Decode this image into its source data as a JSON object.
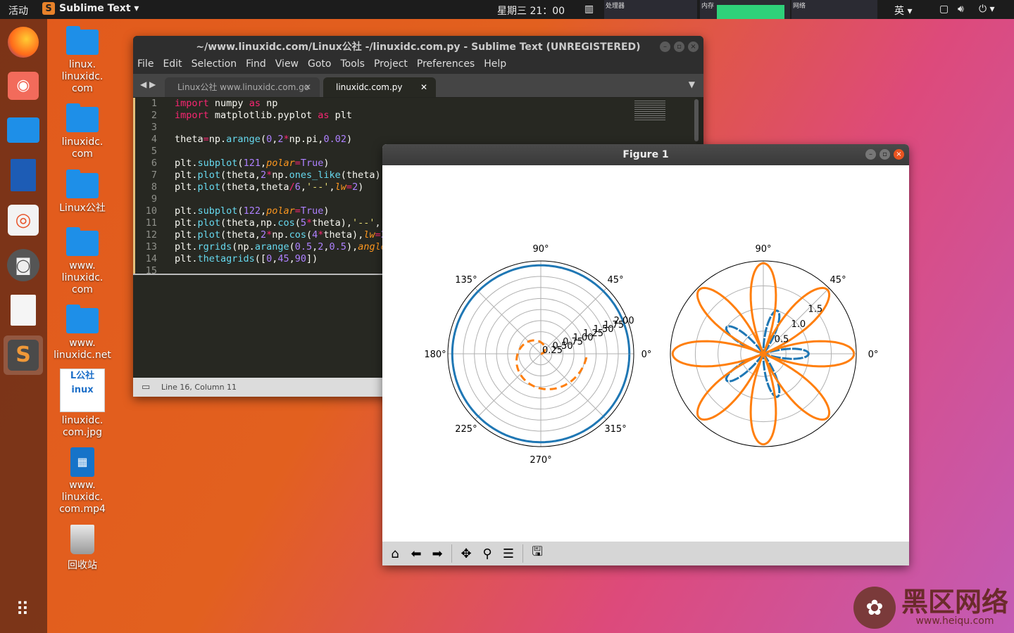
{
  "topbar": {
    "activities": "活动",
    "app_name": "Sublime Text ▾",
    "clock": "星期三 21：00",
    "cpu_label": "处理器",
    "mem_label": "内存",
    "net_label": "网络",
    "ime": "英 ▾"
  },
  "desktop": {
    "icons": [
      {
        "label": "linux.\nlinuxidc.\ncom"
      },
      {
        "label": "linuxidc.\ncom"
      },
      {
        "label": "Linux公社"
      },
      {
        "label": "www.\nlinuxidc.\ncom"
      },
      {
        "label": "www.\nlinuxidc.net"
      },
      {
        "label": "linuxidc.\ncom.jpg"
      },
      {
        "label": "www.\nlinuxidc.\ncom.mp4"
      },
      {
        "label": "回收站"
      }
    ]
  },
  "sublime": {
    "title": "~/www.linuxidc.com/Linux公社 -/linuxidc.com.py - Sublime Text (UNREGISTERED)",
    "menu": [
      "File",
      "Edit",
      "Selection",
      "Find",
      "View",
      "Goto",
      "Tools",
      "Project",
      "Preferences",
      "Help"
    ],
    "tab1": "Linux公社 www.linuxidc.com.go",
    "tab2": "linuxidc.com.py",
    "status": "Line 16, Column 11",
    "line_numbers": [
      "1",
      "2",
      "3",
      "4",
      "5",
      "6",
      "7",
      "8",
      "9",
      "10",
      "11",
      "12",
      "13",
      "14",
      "15"
    ]
  },
  "figure": {
    "title": "Figure 1",
    "left_plot": {
      "angle_labels": [
        "0°",
        "45°",
        "90°",
        "135°",
        "180°",
        "225°",
        "270°",
        "315°"
      ],
      "radial_labels": [
        "0.25",
        "0.50",
        "0.75",
        "1.00",
        "1.25",
        "1.50",
        "1.75",
        "2.00"
      ]
    },
    "right_plot": {
      "angle_labels": [
        "0°",
        "45°",
        "90°"
      ],
      "radial_labels": [
        "0.5",
        "1.0",
        "1.5"
      ]
    },
    "colors": {
      "blue": "#1f77b4",
      "orange": "#ff7f0e"
    }
  },
  "watermark": {
    "text": "黑区网络",
    "url": "www.heiqu.com"
  }
}
